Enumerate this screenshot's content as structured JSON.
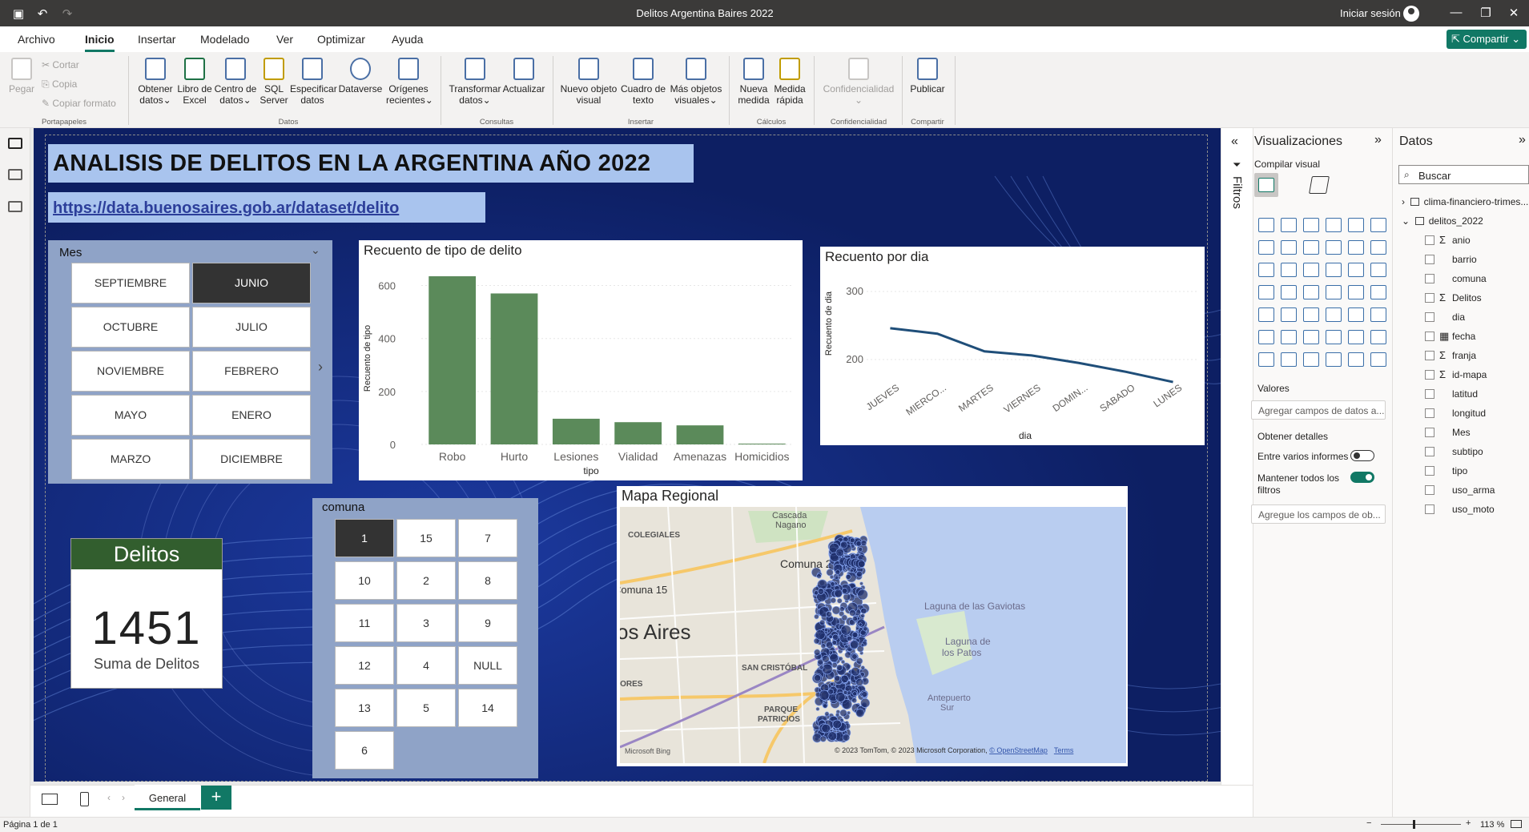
{
  "window": {
    "title": "Delitos Argentina Baires 2022",
    "signin": "Iniciar sesión",
    "share": "Compartir"
  },
  "tabs": [
    "Archivo",
    "Inicio",
    "Insertar",
    "Modelado",
    "Ver",
    "Optimizar",
    "Ayuda"
  ],
  "ribbon": {
    "clipboard": {
      "paste": "Pegar",
      "cut": "Cortar",
      "copy": "Copia",
      "format": "Copiar formato",
      "group": "Portapapeles"
    },
    "data": {
      "b1a": "Obtener",
      "b1b": "datos",
      "b2a": "Libro de",
      "b2b": "Excel",
      "b3a": "Centro de",
      "b3b": "datos",
      "b4a": "SQL",
      "b4b": "Server",
      "b5a": "Especificar",
      "b5b": "datos",
      "b6a": "Dataverse",
      "b7a": "Orígenes",
      "b7b": "recientes",
      "group": "Datos"
    },
    "queries": {
      "b1a": "Transformar",
      "b1b": "datos",
      "b2a": "Actualizar",
      "group": "Consultas"
    },
    "insert": {
      "b1a": "Nuevo objeto",
      "b1b": "visual",
      "b2a": "Cuadro de",
      "b2b": "texto",
      "b3a": "Más objetos",
      "b3b": "visuales",
      "group": "Insertar"
    },
    "calc": {
      "b1a": "Nueva",
      "b1b": "medida",
      "b2a": "Medida",
      "b2b": "rápida",
      "group": "Cálculos"
    },
    "conf": {
      "b1a": "Confidencialidad",
      "group": "Confidencialidad"
    },
    "share": {
      "b1a": "Publicar",
      "group": "Compartir"
    }
  },
  "report": {
    "title": "ANALISIS DE DELITOS EN LA ARGENTINA AÑO 2022",
    "link": "https://data.buenosaires.gob.ar/dataset/delito",
    "mes_slicer": {
      "header": "Mes",
      "items": [
        "SEPTIEMBRE",
        "JUNIO",
        "OCTUBRE",
        "JULIO",
        "NOVIEMBRE",
        "FEBRERO",
        "MAYO",
        "ENERO",
        "MARZO",
        "DICIEMBRE"
      ],
      "selected": "JUNIO"
    },
    "comuna_slicer": {
      "header": "comuna",
      "items": [
        "1",
        "15",
        "7",
        "10",
        "2",
        "8",
        "11",
        "3",
        "9",
        "12",
        "4",
        "NULL",
        "13",
        "5",
        "14",
        "6"
      ],
      "selected": "1"
    },
    "kpi": {
      "header": "Delitos",
      "value": "1451",
      "caption": "Suma de Delitos"
    },
    "map": {
      "title": "Mapa Regional",
      "labels": [
        "Cascada",
        "Nagano",
        "COLEGIALES",
        "Comuna 2",
        "Comuna 15",
        "os Aires",
        "Laguna de las Gaviotas",
        "Laguna de",
        "los Patos",
        "SAN CRISTÓBAL",
        "PARQUE",
        "PATRICIOS",
        "LORES",
        "Antepuerto",
        "Sur"
      ],
      "bing": "Microsoft Bing",
      "copyright": "© 2023 TomTom, © 2023 Microsoft Corporation, ",
      "osm": "© OpenStreetMap",
      "terms": "Terms"
    }
  },
  "chart_data": [
    {
      "type": "bar",
      "title": "Recuento de tipo de delito",
      "xlabel": "tipo",
      "ylabel": "Recuento de tipo",
      "categories": [
        "Robo",
        "Hurto",
        "Lesiones",
        "Vialidad",
        "Amenazas",
        "Homicidios"
      ],
      "values": [
        635,
        570,
        97,
        84,
        72,
        3
      ],
      "ylim": [
        0,
        650
      ],
      "yticks": [
        0,
        200,
        400,
        600
      ],
      "color": "#5b8a5a"
    },
    {
      "type": "line",
      "title": "Recuento por dia",
      "xlabel": "dia",
      "ylabel": "Recuento de dia",
      "categories": [
        "JUEVES",
        "MIERCO...",
        "MARTES",
        "VIERNES",
        "DOMIN...",
        "SABADO",
        "LUNES"
      ],
      "values": [
        246,
        238,
        212,
        206,
        195,
        182,
        167
      ],
      "ylim": [
        160,
        300
      ],
      "yticks": [
        200,
        300
      ],
      "color": "#1f4e79"
    }
  ],
  "visualizations": {
    "title": "Visualizaciones",
    "build": "Compilar visual",
    "values": "Valores",
    "values_placeholder": "Agregar campos de datos a...",
    "drill": "Obtener detalles",
    "cross": "Entre varios informes",
    "keep_a": "Mantener todos los",
    "keep_b": "filtros",
    "drill_placeholder": "Agregue los campos de ob..."
  },
  "data_pane": {
    "title": "Datos",
    "search": "Buscar",
    "tables": [
      "clima-financiero-trimes...",
      "delitos_2022"
    ],
    "fields": [
      {
        "name": "anio",
        "sigma": "Σ"
      },
      {
        "name": "barrio",
        "sigma": ""
      },
      {
        "name": "comuna",
        "sigma": ""
      },
      {
        "name": "Delitos",
        "sigma": "Σ"
      },
      {
        "name": "dia",
        "sigma": ""
      },
      {
        "name": "fecha",
        "sigma": "▦"
      },
      {
        "name": "franja",
        "sigma": "Σ"
      },
      {
        "name": "id-mapa",
        "sigma": "Σ"
      },
      {
        "name": "latitud",
        "sigma": ""
      },
      {
        "name": "longitud",
        "sigma": ""
      },
      {
        "name": "Mes",
        "sigma": ""
      },
      {
        "name": "subtipo",
        "sigma": ""
      },
      {
        "name": "tipo",
        "sigma": ""
      },
      {
        "name": "uso_arma",
        "sigma": ""
      },
      {
        "name": "uso_moto",
        "sigma": ""
      }
    ]
  },
  "filters": {
    "label": "Filtros"
  },
  "pages": {
    "tab": "General",
    "add": "+"
  },
  "status": {
    "page": "Página 1 de 1",
    "zoom": "113 %"
  }
}
